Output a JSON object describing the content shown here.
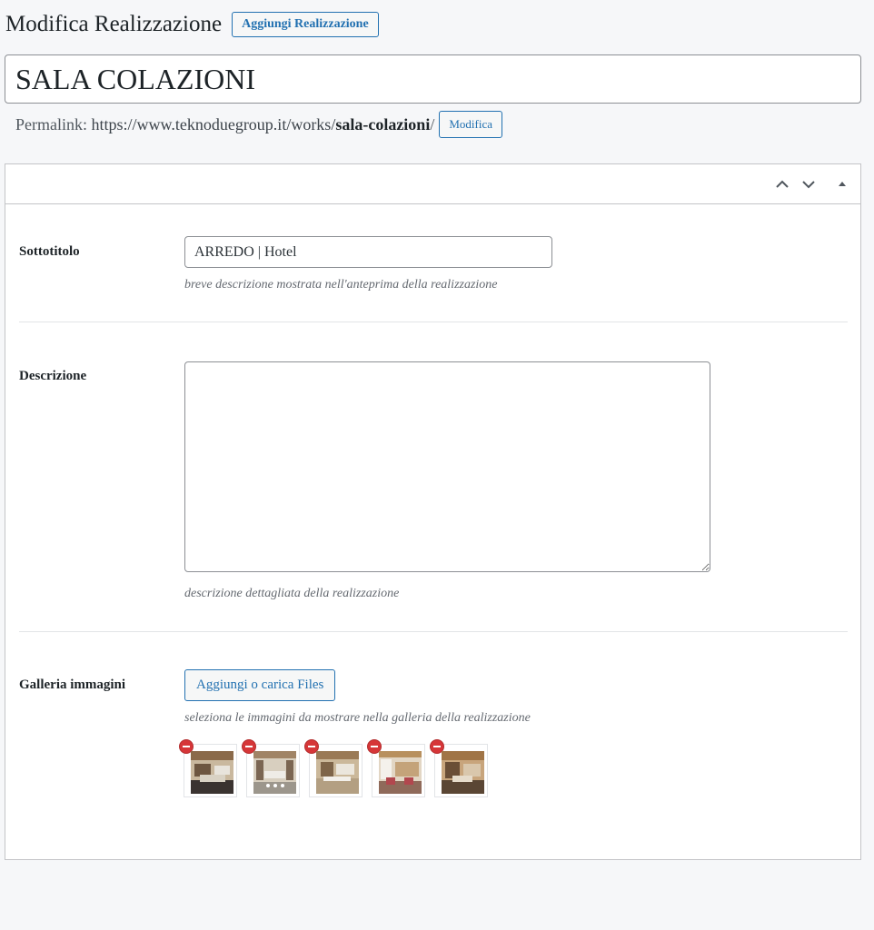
{
  "header": {
    "title": "Modifica Realizzazione",
    "add_button": "Aggiungi Realizzazione"
  },
  "post_title": "SALA COLAZIONI",
  "permalink": {
    "label": "Permalink:",
    "base_url": "https://www.teknoduegroup.it/works/",
    "slug": "sala-colazioni",
    "trailing": "/",
    "edit_button": "Modifica"
  },
  "metabox": {
    "controls": [
      "chevron-up-icon",
      "chevron-down-icon",
      "triangle-up-icon"
    ],
    "fields": {
      "subtitle": {
        "label": "Sottotitolo",
        "value": "ARREDO | Hotel",
        "hint": "breve descrizione mostrata nell'anteprima della realizzazione"
      },
      "description": {
        "label": "Descrizione",
        "value": "",
        "hint": "descrizione dettagliata della realizzazione"
      },
      "gallery": {
        "label": "Galleria immagini",
        "button": "Aggiungi o carica Files",
        "hint": "seleziona le immagini da mostrare nella galleria della realizzazione",
        "image_count": 5
      }
    }
  },
  "colors": {
    "accent": "#2271b1",
    "remove": "#d63638",
    "background": "#f6f7f9"
  }
}
